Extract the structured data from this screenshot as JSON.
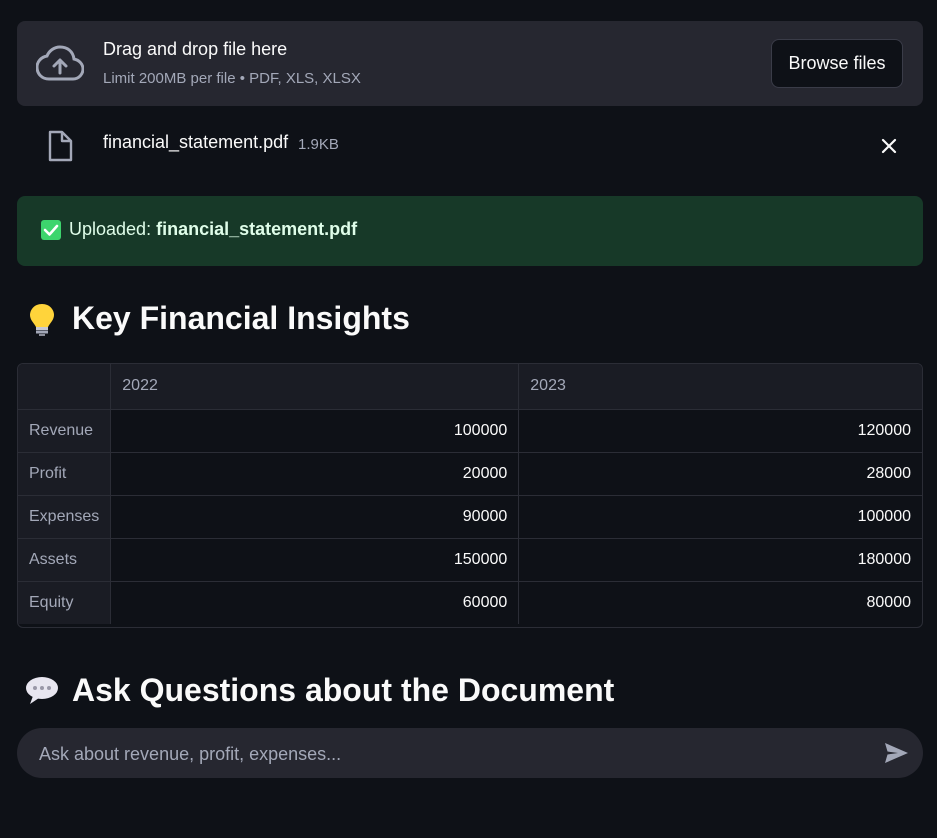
{
  "uploader": {
    "title": "Drag and drop file here",
    "limit": "Limit 200MB per file • PDF, XLS, XLSX",
    "browse_label": "Browse files"
  },
  "file": {
    "name": "financial_statement.pdf",
    "size": "1.9KB"
  },
  "success": {
    "prefix": "Uploaded: ",
    "filename": "financial_statement.pdf"
  },
  "insights": {
    "title": "Key Financial Insights",
    "columns": [
      "",
      "2022",
      "2023"
    ],
    "rows": [
      {
        "label": "Revenue",
        "v2022": "100000",
        "v2023": "120000"
      },
      {
        "label": "Profit",
        "v2022": "20000",
        "v2023": "28000"
      },
      {
        "label": "Expenses",
        "v2022": "90000",
        "v2023": "100000"
      },
      {
        "label": "Assets",
        "v2022": "150000",
        "v2023": "180000"
      },
      {
        "label": "Equity",
        "v2022": "60000",
        "v2023": "80000"
      }
    ]
  },
  "questions": {
    "title": "Ask Questions about the Document",
    "placeholder": "Ask about revenue, profit, expenses..."
  },
  "colors": {
    "background": "#0e1117",
    "panel": "#262730",
    "success_bg": "#173928",
    "success_text": "#dffde9",
    "check": "#3dd56d"
  }
}
